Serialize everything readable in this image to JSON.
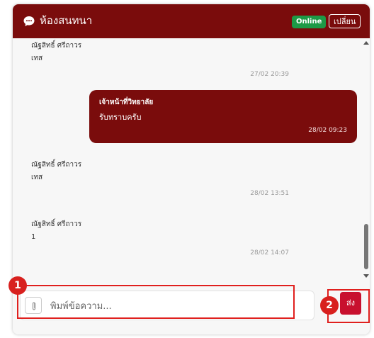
{
  "header": {
    "title": "ห้องสนทนา",
    "status_badge": "Online",
    "change_label": "เปลี่ยน",
    "accent": "#7a0c0c"
  },
  "messages": [
    {
      "side": "left",
      "sender": "ณัฐสิทธิ์ ศรีถาวร",
      "text": "เทส",
      "time": "27/02 20:39"
    },
    {
      "side": "right",
      "sender": "เจ้าหน้าที่วิทยาลัย",
      "text": "รับทราบครับ",
      "time": "28/02 09:23"
    },
    {
      "side": "left",
      "sender": "ณัฐสิทธิ์ ศรีถาวร",
      "text": "เทส",
      "time": "28/02 13:51"
    },
    {
      "side": "left",
      "sender": "ณัฐสิทธิ์ ศรีถาวร",
      "text": "1",
      "time": "28/02 14:07"
    }
  ],
  "composer": {
    "placeholder": "พิมพ์ข้อความ...",
    "attach_icon": "paperclip-icon",
    "send_label": "ส่ง",
    "send_color": "#c8102e"
  },
  "callouts": {
    "one": "1",
    "two": "2",
    "color": "#e0201e"
  }
}
